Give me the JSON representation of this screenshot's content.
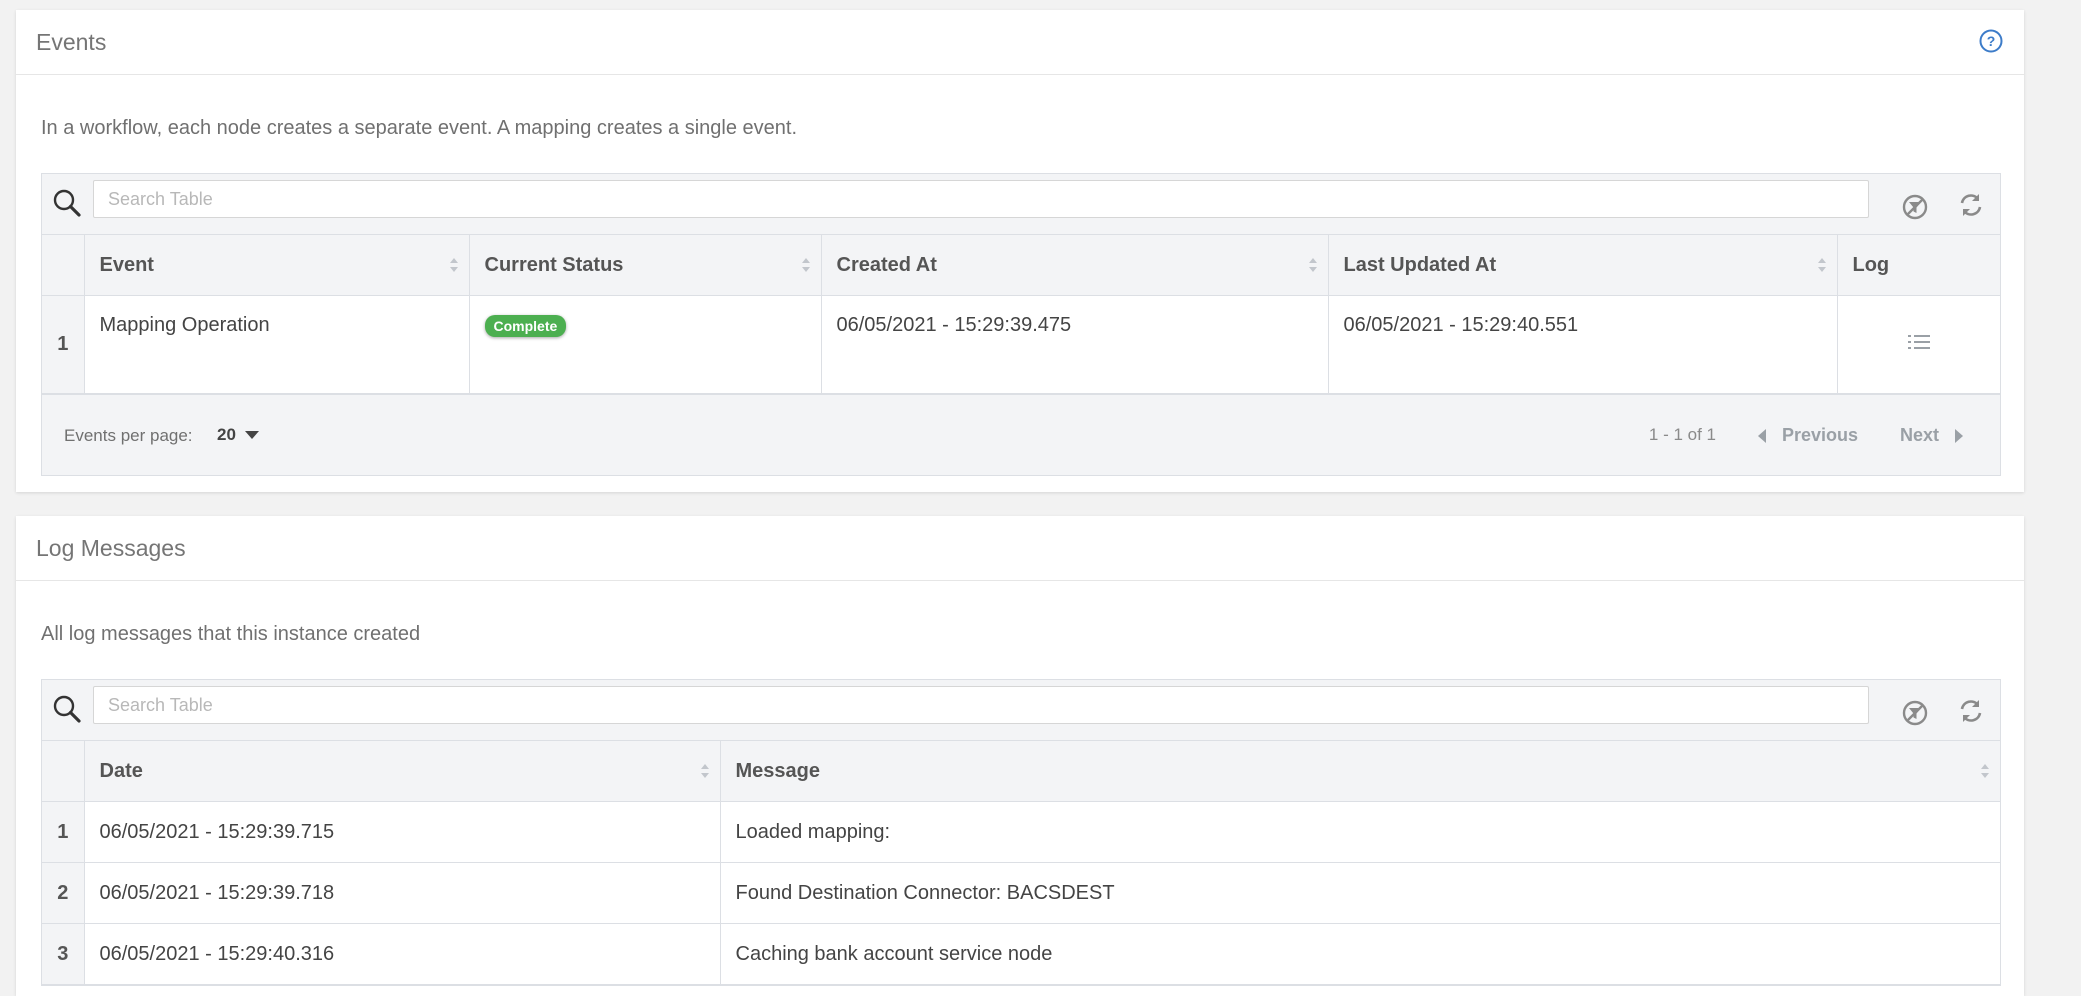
{
  "events": {
    "title": "Events",
    "help_icon": "question-circle-icon",
    "description": "In a workflow, each node creates a separate event. A mapping creates a single event.",
    "search_placeholder": "Search Table",
    "columns": [
      "Event",
      "Current Status",
      "Created At",
      "Last Updated At",
      "Log"
    ],
    "rows": [
      {
        "index": "1",
        "event": "Mapping Operation",
        "status": "Complete",
        "created_at": "06/05/2021 - 15:29:39.475",
        "updated_at": "06/05/2021 - 15:29:40.551",
        "log_icon": "list-icon"
      }
    ],
    "footer": {
      "per_page_label": "Events per page:",
      "per_page_value": "20",
      "range": "1 - 1 of 1",
      "previous": "Previous",
      "next": "Next"
    }
  },
  "logs": {
    "title": "Log Messages",
    "description": "All log messages that this instance created",
    "search_placeholder": "Search Table",
    "columns": [
      "Date",
      "Message"
    ],
    "rows": [
      {
        "index": "1",
        "date": "06/05/2021 - 15:29:39.715",
        "message": "Loaded mapping:"
      },
      {
        "index": "2",
        "date": "06/05/2021 - 15:29:39.718",
        "message": "Found Destination Connector: BACSDEST"
      },
      {
        "index": "3",
        "date": "06/05/2021 - 15:29:40.316",
        "message": "Caching bank account service node"
      }
    ]
  },
  "colors": {
    "status_complete": "#4caf50",
    "help_icon": "#3d7cc9"
  }
}
